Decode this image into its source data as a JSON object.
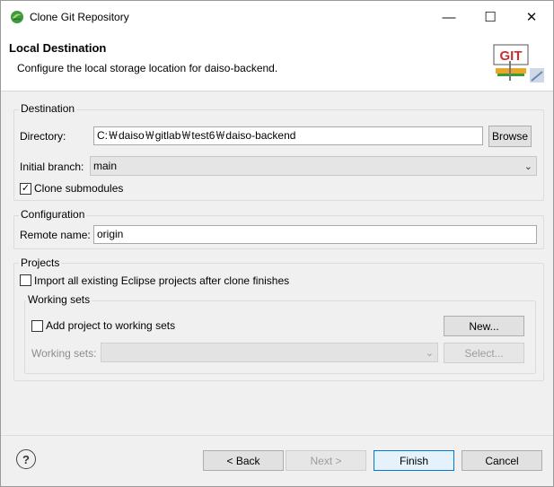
{
  "window": {
    "title": "Clone Git Repository",
    "controls": {
      "minimize": "—",
      "maximize": "☐",
      "close": "✕"
    }
  },
  "banner": {
    "title": "Local Destination",
    "message": "Configure the local storage location for daiso-backend.",
    "logo_text": "GIT"
  },
  "destination": {
    "group_label": "Destination",
    "directory_label": "Directory:",
    "directory_value": "C:￦daiso￦gitlab￦test6￦daiso-backend",
    "browse_label": "Browse",
    "branch_label": "Initial branch:",
    "branch_value": "main",
    "clone_submodules_label": "Clone submodules",
    "clone_submodules_checked": true
  },
  "configuration": {
    "group_label": "Configuration",
    "remote_name_label": "Remote name:",
    "remote_name_value": "origin"
  },
  "projects": {
    "group_label": "Projects",
    "import_label": "Import all existing Eclipse projects after clone finishes",
    "import_checked": false,
    "working_sets": {
      "group_label": "Working sets",
      "add_label": "Add project to working sets",
      "add_checked": false,
      "new_label": "New...",
      "sets_label": "Working sets:",
      "sets_value": "",
      "select_label": "Select..."
    }
  },
  "footer": {
    "help_icon": "?",
    "back_label": "< Back",
    "next_label": "Next >",
    "finish_label": "Finish",
    "cancel_label": "Cancel"
  },
  "colors": {
    "accent": "#0078d7",
    "window_bg": "#f0f0f0",
    "logo_green": "#3a9b3a"
  }
}
